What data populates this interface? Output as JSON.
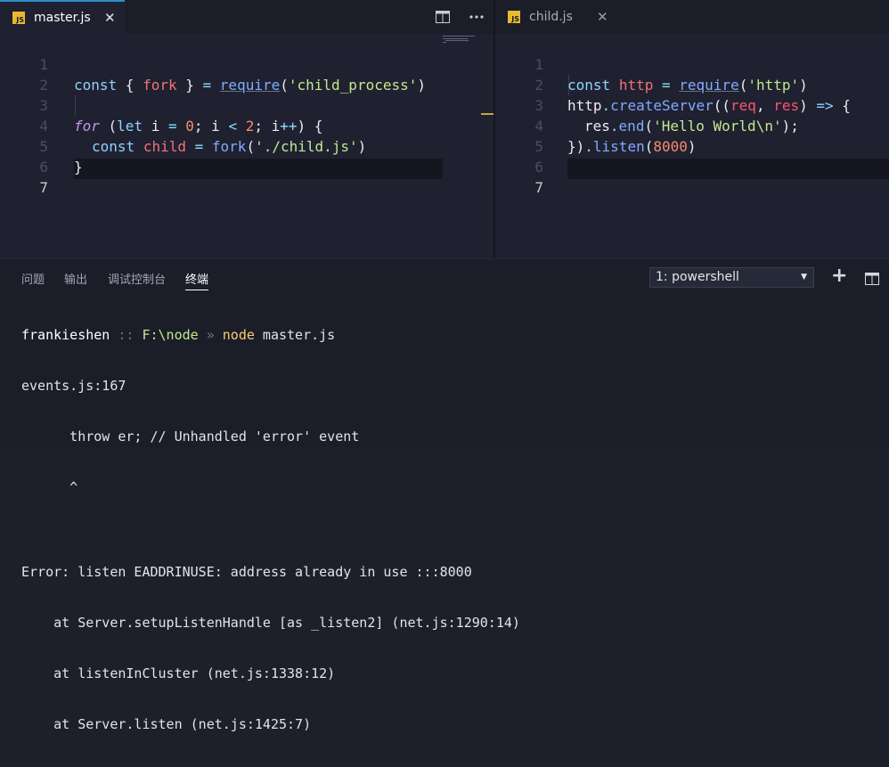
{
  "editor_left": {
    "tab": {
      "icon": "JS",
      "name": "master.js",
      "close": "✕"
    },
    "line_numbers": [
      "1",
      "2",
      "3",
      "4",
      "5",
      "6",
      "7"
    ],
    "current_line": "7",
    "code": {
      "l1": {
        "a": "const",
        "b": " { ",
        "c": "fork",
        "d": " } ",
        "e": "=",
        "f": " ",
        "g": "require",
        "h": "(",
        "i": "'child_process'",
        "j": ")"
      },
      "l3": {
        "a": "for",
        "b": " (",
        "c": "let",
        "d": " i ",
        "e": "=",
        "f": " ",
        "g": "0",
        "h": "; i ",
        "i": "<",
        "j": " ",
        "k": "2",
        "l": "; i",
        "m": "++",
        "n": ") {"
      },
      "l4": {
        "a": "const",
        "b": " ",
        "c": "child",
        "d": " ",
        "e": "=",
        "f": " ",
        "g": "fork",
        "h": "(",
        "i": "'./child.js'",
        "j": ")"
      },
      "l5": {
        "a": "}"
      }
    }
  },
  "editor_right": {
    "tab": {
      "icon": "JS",
      "name": "child.js",
      "close": "✕"
    },
    "line_numbers": [
      "1",
      "2",
      "3",
      "4",
      "5",
      "6",
      "7"
    ],
    "current_line": "7",
    "code": {
      "l1": {
        "a": "const",
        "b": " ",
        "c": "http",
        "d": " ",
        "e": "=",
        "f": " ",
        "g": "require",
        "h": "(",
        "i": "'http'",
        "j": ")"
      },
      "l2": {
        "a": "http",
        "b": ".",
        "c": "createServer",
        "d": "((",
        "e": "req",
        "f": ", ",
        "g": "res",
        "h": ") ",
        "i": "=>",
        "j": " {"
      },
      "l3": {
        "a": "res",
        "b": ".",
        "c": "end",
        "d": "(",
        "e": "'Hello World\\n'",
        "f": ");"
      },
      "l4": {
        "a": "})",
        "b": ".",
        "c": "listen",
        "d": "(",
        "e": "8000",
        "f": ")"
      }
    }
  },
  "panel": {
    "tabs": [
      "问题",
      "输出",
      "调试控制台",
      "终端"
    ],
    "active_tab": "终端",
    "terminal_select": "1: powershell",
    "add_label": "+",
    "split_icon": "split-panel-icon"
  },
  "terminal": {
    "prompt_user": "frankieshen",
    "prompt_sep": " :: ",
    "prompt_path": "F:\\node",
    "prompt_arrow": " » ",
    "prompt_cmd": "node",
    "prompt_arg": " master.js",
    "lines": [
      "events.js:167",
      "      throw er; // Unhandled 'error' event",
      "      ^",
      "",
      "Error: listen EADDRINUSE: address already in use :::8000",
      "    at Server.setupListenHandle [as _listen2] (net.js:1290:14)",
      "    at listenInCluster (net.js:1338:12)",
      "    at Server.listen (net.js:1425:7)"
    ]
  },
  "colors": {
    "accent": "#2f8fc9",
    "js_icon": "#e8b832",
    "string": "#c3e88d",
    "keyword": "#8fd2ff",
    "variable": "#f07178"
  }
}
